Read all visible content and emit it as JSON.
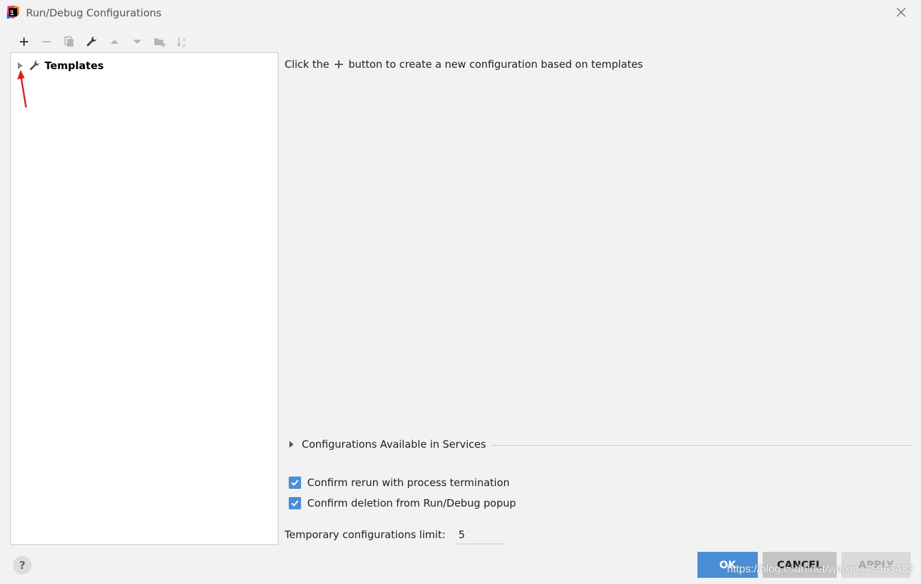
{
  "window": {
    "title": "Run/Debug Configurations"
  },
  "toolbar": {
    "items": [
      {
        "icon": "add-icon",
        "enabled": true
      },
      {
        "icon": "remove-icon",
        "enabled": false
      },
      {
        "icon": "copy-icon",
        "enabled": false
      },
      {
        "icon": "wrench-icon",
        "enabled": true
      },
      {
        "icon": "move-up-icon",
        "enabled": false
      },
      {
        "icon": "move-down-icon",
        "enabled": false
      },
      {
        "icon": "new-folder-icon",
        "enabled": false
      },
      {
        "icon": "sort-alpha-icon",
        "enabled": false
      }
    ]
  },
  "tree": {
    "root_label": "Templates"
  },
  "main": {
    "hint_before": "Click the",
    "hint_after": "button to create a new configuration based on templates",
    "services_label": "Configurations Available in Services",
    "checkboxes": [
      {
        "label": "Confirm rerun with process termination",
        "checked": true
      },
      {
        "label": "Confirm deletion from Run/Debug popup",
        "checked": true
      }
    ],
    "limit_label": "Temporary configurations limit:",
    "limit_value": "5"
  },
  "footer": {
    "help_label": "?",
    "ok_label": "OK",
    "cancel_label": "CANCEL",
    "apply_label": "APPLY",
    "watermark": "https://blog.csdn.net/weixin_45965432"
  },
  "colors": {
    "accent": "#4a8fd6",
    "background": "#f2f2f2",
    "annotation": "#e02020"
  }
}
